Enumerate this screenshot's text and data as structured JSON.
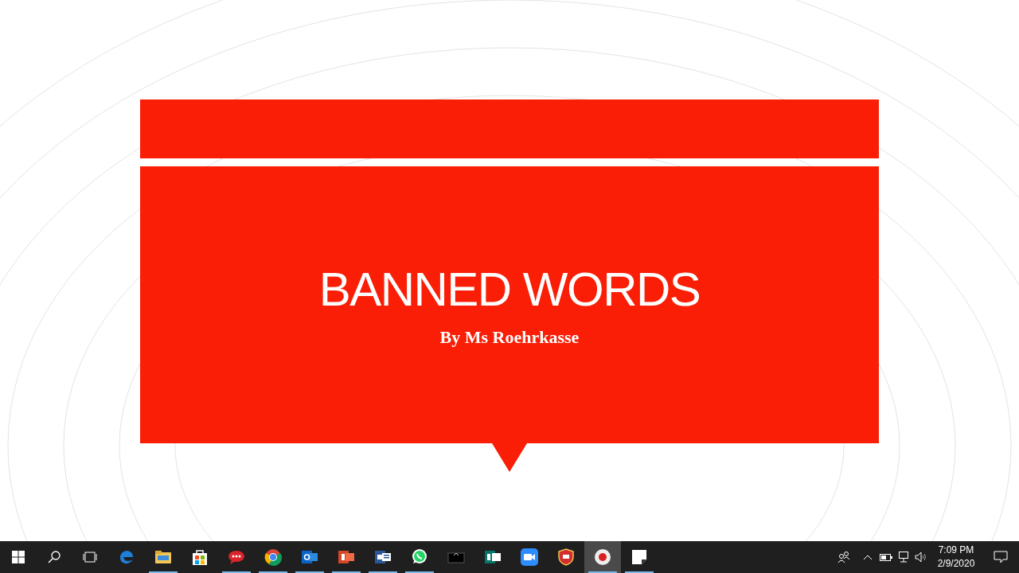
{
  "slide": {
    "title": "BANNED WORDS",
    "subtitle": "By Ms Roehrkasse"
  },
  "taskbar": {
    "apps": [
      {
        "kind": "folder",
        "running": true,
        "selected": false
      },
      {
        "kind": "bag",
        "running": false,
        "selected": false
      },
      {
        "kind": "chat",
        "running": true,
        "selected": false
      },
      {
        "kind": "globe",
        "running": true,
        "selected": false
      },
      {
        "kind": "mail",
        "running": true,
        "selected": false
      },
      {
        "kind": "slides",
        "running": true,
        "selected": false
      },
      {
        "kind": "doc",
        "running": true,
        "selected": false
      },
      {
        "kind": "phone",
        "running": true,
        "selected": false
      },
      {
        "kind": "tray",
        "running": false,
        "selected": false
      },
      {
        "kind": "sheet",
        "running": false,
        "selected": false
      },
      {
        "kind": "camera",
        "running": false,
        "selected": false
      },
      {
        "kind": "shield",
        "running": false,
        "selected": false
      },
      {
        "kind": "record",
        "running": true,
        "selected": true
      },
      {
        "kind": "note",
        "running": true,
        "selected": false
      }
    ],
    "time": "7:09 PM",
    "date": "2/9/2020"
  }
}
